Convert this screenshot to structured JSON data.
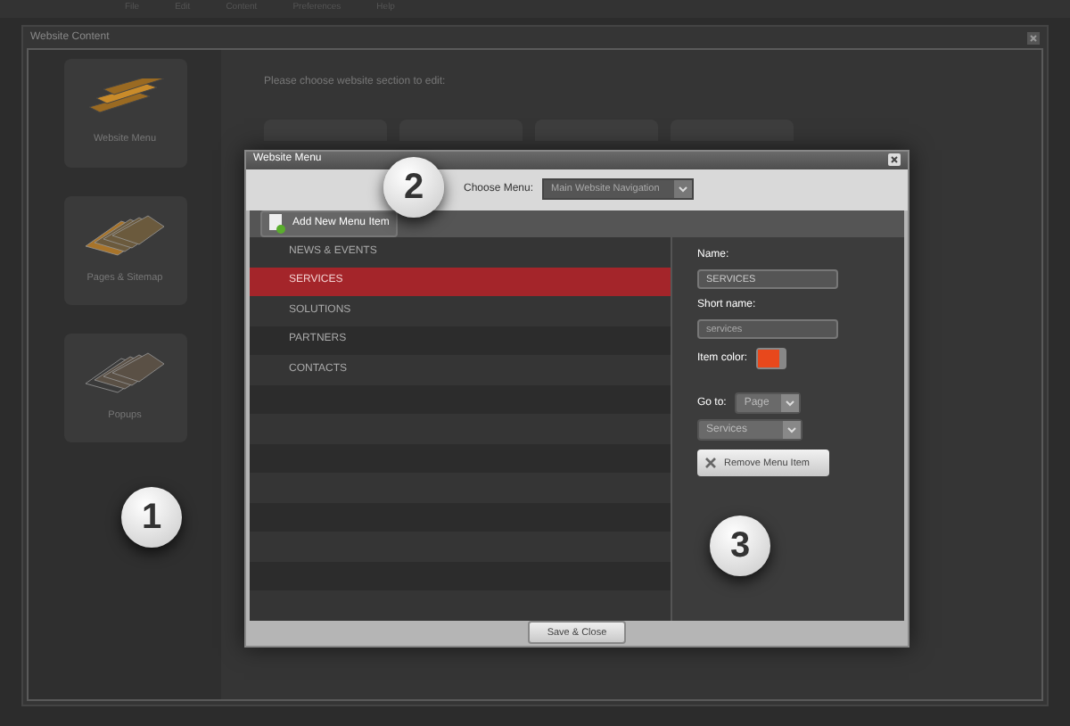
{
  "menu_bar": [
    "File",
    "Edit",
    "Content",
    "Preferences",
    "Help"
  ],
  "window": {
    "title": "Website Content"
  },
  "sidebar": {
    "items": [
      {
        "label": "Website Menu",
        "kind": "stripes"
      },
      {
        "label": "Pages & Sitemap",
        "kind": "pages"
      },
      {
        "label": "Popups",
        "kind": "popups"
      }
    ]
  },
  "content": {
    "prompt": "Please choose website section to edit:"
  },
  "callouts": [
    "1",
    "2",
    "3"
  ],
  "dialog": {
    "title": "Website Menu",
    "choose_menu": {
      "label": "Choose Menu:",
      "value": "Main Website Navigation"
    },
    "add_button": "Add New Menu Item",
    "items": [
      {
        "label": "NEWS & EVENTS",
        "selected": false
      },
      {
        "label": "SERVICES",
        "selected": true
      },
      {
        "label": "SOLUTIONS",
        "selected": false
      },
      {
        "label": "PARTNERS",
        "selected": false
      },
      {
        "label": "CONTACTS",
        "selected": false
      }
    ],
    "details": {
      "name_label": "Name:",
      "name_value": "SERVICES",
      "short_label": "Short name:",
      "short_value": "services",
      "color_label": "Item color:",
      "color": "#e8481c",
      "goto_label": "Go to:",
      "goto_type": "Page",
      "goto_target": "Services",
      "remove_button": "Remove Menu Item"
    },
    "save_button": "Save & Close"
  }
}
